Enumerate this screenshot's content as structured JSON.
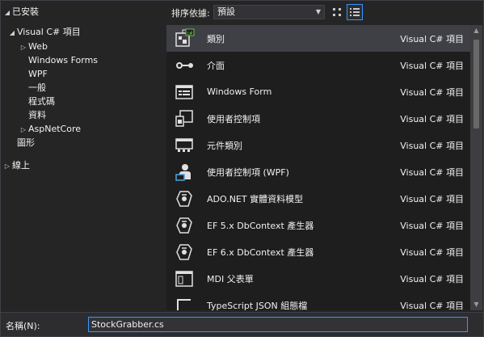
{
  "tree": {
    "installed": "已安裝",
    "visual_csharp": "Visual C# 項目",
    "children": [
      "Web",
      "Windows Forms",
      "WPF",
      "一般",
      "程式碼",
      "資料",
      "AspNetCore"
    ],
    "graphics": "圖形",
    "online": "線上"
  },
  "toolbar": {
    "sort_label": "排序依據:",
    "sort_value": "預設"
  },
  "templates": [
    {
      "name": "類別",
      "lang": "Visual C# 項目",
      "icon": "class-icon"
    },
    {
      "name": "介面",
      "lang": "Visual C# 項目",
      "icon": "interface-icon"
    },
    {
      "name": "Windows Form",
      "lang": "Visual C# 項目",
      "icon": "windows-form-icon"
    },
    {
      "name": "使用者控制項",
      "lang": "Visual C# 項目",
      "icon": "user-control-icon"
    },
    {
      "name": "元件類別",
      "lang": "Visual C# 項目",
      "icon": "component-class-icon"
    },
    {
      "name": "使用者控制項 (WPF)",
      "lang": "Visual C# 項目",
      "icon": "user-control-wpf-icon"
    },
    {
      "name": "ADO.NET 實體資料模型",
      "lang": "Visual C# 項目",
      "icon": "ado-net-entity-model-icon"
    },
    {
      "name": "EF 5.x DbContext 產生器",
      "lang": "Visual C# 項目",
      "icon": "ef-generator-icon"
    },
    {
      "name": "EF 6.x DbContext 產生器",
      "lang": "Visual C# 項目",
      "icon": "ef-generator-icon"
    },
    {
      "name": "MDI 父表單",
      "lang": "Visual C# 項目",
      "icon": "mdi-parent-form-icon"
    },
    {
      "name": "TypeScript JSON 組態檔",
      "lang": "Visual C# 項目",
      "icon": "typescript-json-icon"
    }
  ],
  "bottom": {
    "name_label": "名稱(N):",
    "name_value": "StockGrabber.cs"
  }
}
